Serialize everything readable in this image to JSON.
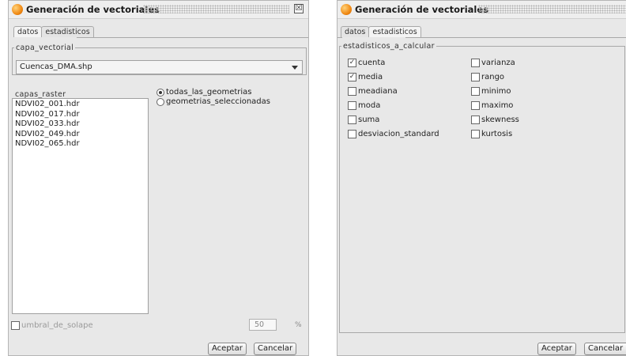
{
  "left_window": {
    "title": "Generación de vectoriales",
    "tabs": [
      {
        "label": "datos"
      },
      {
        "label": "estadisticos"
      }
    ],
    "capa_vectorial": {
      "label": "capa_vectorial",
      "value": "Cuencas_DMA.shp"
    },
    "capas_raster": {
      "label": "capas_raster",
      "items": [
        "NDVI02_001.hdr",
        "NDVI02_017.hdr",
        "NDVI02_033.hdr",
        "NDVI02_049.hdr",
        "NDVI02_065.hdr"
      ]
    },
    "radio_options": [
      {
        "label": "todas_las_geometrias",
        "selected": true
      },
      {
        "label": "geometrias_seleccionadas",
        "selected": false
      }
    ],
    "umbral": {
      "label": "umbral_de_solape",
      "value": "50",
      "unit": "%",
      "checked": false
    },
    "buttons": {
      "accept": "Aceptar",
      "cancel": "Cancelar"
    }
  },
  "right_window": {
    "title": "Generación de vectoriales",
    "tabs": [
      {
        "label": "datos"
      },
      {
        "label": "estadisticos"
      }
    ],
    "group_label": "estadisticos_a_calcular",
    "stats_col1": [
      {
        "label": "cuenta",
        "checked": true
      },
      {
        "label": "media",
        "checked": true
      },
      {
        "label": "meadiana",
        "checked": false
      },
      {
        "label": "moda",
        "checked": false
      },
      {
        "label": "suma",
        "checked": false
      },
      {
        "label": "desviacion_standard",
        "checked": false
      }
    ],
    "stats_col2": [
      {
        "label": "varianza",
        "checked": false
      },
      {
        "label": "rango",
        "checked": false
      },
      {
        "label": "minimo",
        "checked": false
      },
      {
        "label": "maximo",
        "checked": false
      },
      {
        "label": "skewness",
        "checked": false
      },
      {
        "label": "kurtosis",
        "checked": false
      }
    ],
    "buttons": {
      "accept": "Aceptar",
      "cancel": "Cancelar"
    },
    "check_mark": "✓",
    "close_glyph": "☒"
  }
}
